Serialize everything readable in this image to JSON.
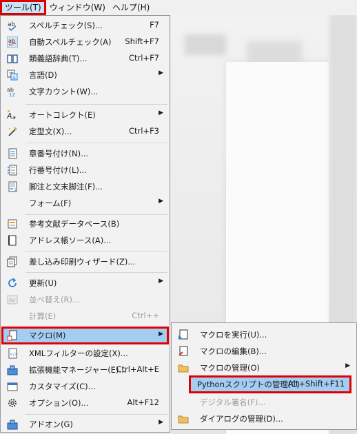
{
  "menubar": {
    "items": [
      {
        "label": "ツール(T)"
      },
      {
        "label": "ウィンドウ(W)"
      },
      {
        "label": "ヘルプ(H)"
      }
    ]
  },
  "tools_menu": {
    "items": [
      {
        "label": "スペルチェック(S)...",
        "shortcut": "F7"
      },
      {
        "label": "自動スペルチェック(A)",
        "shortcut": "Shift+F7"
      },
      {
        "label": "類義語辞典(T)...",
        "shortcut": "Ctrl+F7"
      },
      {
        "label": "言語(D)",
        "shortcut": ""
      },
      {
        "label": "文字カウント(W)...",
        "shortcut": ""
      },
      {
        "label": "オートコレクト(E)",
        "shortcut": ""
      },
      {
        "label": "定型文(X)...",
        "shortcut": "Ctrl+F3"
      },
      {
        "label": "章番号付け(N)...",
        "shortcut": ""
      },
      {
        "label": "行番号付け(L)...",
        "shortcut": ""
      },
      {
        "label": "脚注と文末脚注(F)...",
        "shortcut": ""
      },
      {
        "label": "フォーム(F)",
        "shortcut": ""
      },
      {
        "label": "参考文献データベース(B)",
        "shortcut": ""
      },
      {
        "label": "アドレス帳ソース(A)...",
        "shortcut": ""
      },
      {
        "label": "差し込み印刷ウィザード(Z)...",
        "shortcut": ""
      },
      {
        "label": "更新(U)",
        "shortcut": ""
      },
      {
        "label": "並べ替え(R)...",
        "shortcut": ""
      },
      {
        "label": "計算(E)",
        "shortcut": "Ctrl++"
      },
      {
        "label": "マクロ(M)",
        "shortcut": ""
      },
      {
        "label": "XMLフィルターの設定(X)...",
        "shortcut": ""
      },
      {
        "label": "拡張機能マネージャー(E)...",
        "shortcut": "Ctrl+Alt+E"
      },
      {
        "label": "カスタマイズ(C)...",
        "shortcut": ""
      },
      {
        "label": "オプション(O)...",
        "shortcut": "Alt+F12"
      },
      {
        "label": "アドオン(G)",
        "shortcut": ""
      }
    ]
  },
  "macro_submenu": {
    "items": [
      {
        "label": "マクロを実行(U)...",
        "shortcut": ""
      },
      {
        "label": "マクロの編集(B)...",
        "shortcut": ""
      },
      {
        "label": "マクロの管理(O)",
        "shortcut": ""
      },
      {
        "label": "Pythonスクリプトの管理(C)",
        "shortcut": "Alt+Shift+F11"
      },
      {
        "label": "デジタル署名(F)...",
        "shortcut": ""
      },
      {
        "label": "ダイアログの管理(D)...",
        "shortcut": ""
      }
    ]
  },
  "submenu_arrow": "▶",
  "colors": {
    "highlight": "#a3cdf2",
    "annotation_box": "#e00000",
    "menu_bg": "#f2f2f2"
  }
}
